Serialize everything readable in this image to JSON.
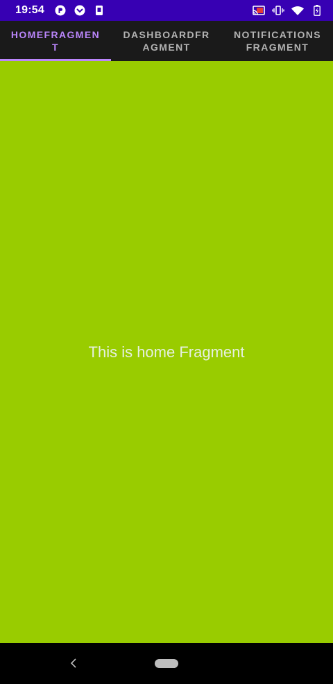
{
  "status_bar": {
    "time": "19:54",
    "left_icons": [
      "app-icon",
      "pocket-icon",
      "screenshot-icon"
    ],
    "right_icons": [
      "cast-icon",
      "vibrate-icon",
      "wifi-icon",
      "battery-icon"
    ],
    "background": "#3700b3"
  },
  "tabs": [
    {
      "label": "HOMEFRAGMENT",
      "selected": true
    },
    {
      "label": "DASHBOARDFRAGMENT",
      "selected": false
    },
    {
      "label": "NOTIFICATIONS FRAGMENT",
      "selected": false
    }
  ],
  "content": {
    "text": "This is home Fragment",
    "background": "#99cc00"
  },
  "colors": {
    "accent": "#bb86fc",
    "tab_bar": "#1a1a1a"
  },
  "nav_bar": {
    "buttons": [
      "back-icon",
      "home-pill"
    ]
  }
}
